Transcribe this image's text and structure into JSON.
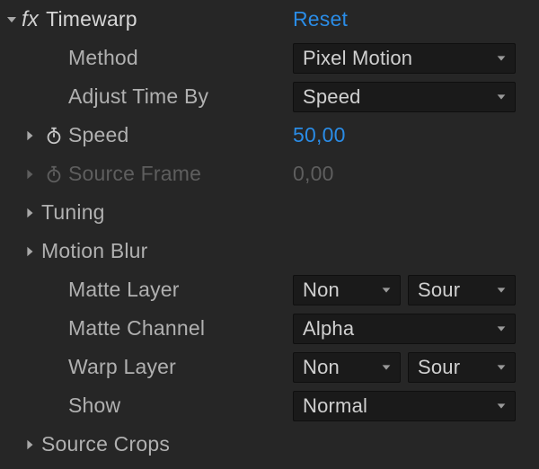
{
  "effect": {
    "fx_label": "fx",
    "name": "Timewarp",
    "reset": "Reset"
  },
  "props": {
    "method": {
      "label": "Method",
      "value": "Pixel Motion"
    },
    "adjust_time_by": {
      "label": "Adjust Time By",
      "value": "Speed"
    },
    "speed": {
      "label": "Speed",
      "value": "50,00"
    },
    "source_frame": {
      "label": "Source Frame",
      "value": "0,00"
    },
    "tuning": {
      "label": "Tuning"
    },
    "motion_blur": {
      "label": "Motion Blur"
    },
    "matte_layer": {
      "label": "Matte Layer",
      "left": "Non",
      "right": "Sour"
    },
    "matte_channel": {
      "label": "Matte Channel",
      "value": "Alpha"
    },
    "warp_layer": {
      "label": "Warp Layer",
      "left": "Non",
      "right": "Sour"
    },
    "show": {
      "label": "Show",
      "value": "Normal"
    },
    "source_crops": {
      "label": "Source Crops"
    }
  }
}
